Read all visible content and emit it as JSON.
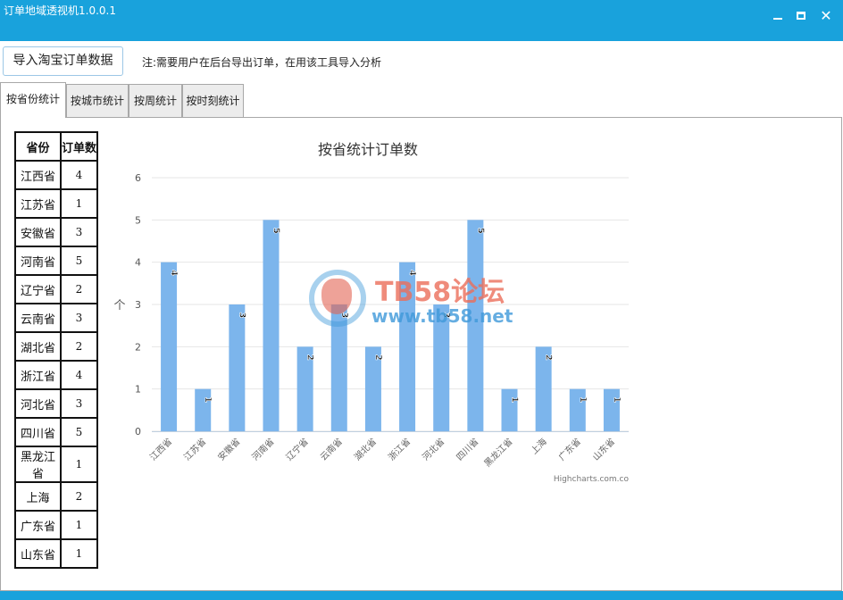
{
  "window": {
    "title": "订单地域透视机1.0.0.1",
    "min_label": "minimize",
    "max_label": "maximize",
    "close_glyph": "✕"
  },
  "toolbar": {
    "import_label": "导入淘宝订单数据",
    "note": "注:需要用户在后台导出订单，在用该工具导入分析"
  },
  "tabs": [
    {
      "label": "按省份统计",
      "active": true
    },
    {
      "label": "按城市统计",
      "active": false
    },
    {
      "label": "按周统计",
      "active": false
    },
    {
      "label": "按时刻统计",
      "active": false
    }
  ],
  "table": {
    "headers": [
      "省份",
      "订单数"
    ],
    "rows": [
      [
        "江西省",
        "4"
      ],
      [
        "江苏省",
        "1"
      ],
      [
        "安徽省",
        "3"
      ],
      [
        "河南省",
        "5"
      ],
      [
        "辽宁省",
        "2"
      ],
      [
        "云南省",
        "3"
      ],
      [
        "湖北省",
        "2"
      ],
      [
        "浙江省",
        "4"
      ],
      [
        "河北省",
        "3"
      ],
      [
        "四川省",
        "5"
      ],
      [
        "黑龙江省",
        "1"
      ],
      [
        "上海",
        "2"
      ],
      [
        "广东省",
        "1"
      ],
      [
        "山东省",
        "1"
      ]
    ]
  },
  "chart_data": {
    "type": "bar",
    "title": "按省统计订单数",
    "ylabel": "个",
    "xlabel": "",
    "categories": [
      "江西省",
      "江苏省",
      "安徽省",
      "河南省",
      "辽宁省",
      "云南省",
      "湖北省",
      "浙江省",
      "河北省",
      "四川省",
      "黑龙江省",
      "上海",
      "广东省",
      "山东省"
    ],
    "values": [
      4,
      1,
      3,
      5,
      2,
      3,
      2,
      4,
      3,
      5,
      1,
      2,
      1,
      1
    ],
    "ylim": [
      0,
      6
    ],
    "yticks": [
      "0",
      "1",
      "2",
      "3",
      "4",
      "5",
      "6"
    ],
    "grid": true,
    "legend": "none",
    "bar_color": "#7cb5ec",
    "credit": "Highcharts.com.co"
  },
  "watermark": {
    "text1": "TB58论坛",
    "text2": "www.tb58.net"
  },
  "colors": {
    "titlebar": "#19a2dc",
    "bar": "#7cb5ec"
  }
}
